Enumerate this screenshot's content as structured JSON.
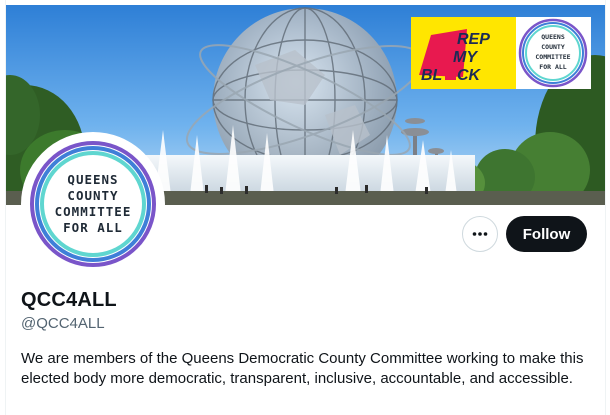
{
  "profile": {
    "display_name": "QCC4ALL",
    "handle": "@QCC4ALL",
    "bio": "We are members of the Queens Democratic County Committee working to make this elected body more democratic, transparent, inclusive, accountable, and accessible."
  },
  "avatar": {
    "logo_lines": [
      "QUEENS",
      "COUNTY",
      "COMMITTEE",
      "FOR ALL"
    ]
  },
  "banner": {
    "rep_logo_lines": [
      "REP",
      "MY",
      "BL",
      "CK"
    ],
    "small_logo_lines": [
      "QUEENS",
      "COUNTY",
      "COMMITTEE",
      "FOR ALL"
    ]
  },
  "actions": {
    "more_icon": "more-horizontal-icon",
    "follow_label": "Follow"
  },
  "colors": {
    "follow_bg": "#0f1419",
    "handle_text": "#536471",
    "rep_yellow": "#ffe600",
    "rep_pink": "#e8194f",
    "ring_blue": "#3f7fd8",
    "ring_teal": "#5fd6d0",
    "ring_purple": "#7a55c9"
  }
}
